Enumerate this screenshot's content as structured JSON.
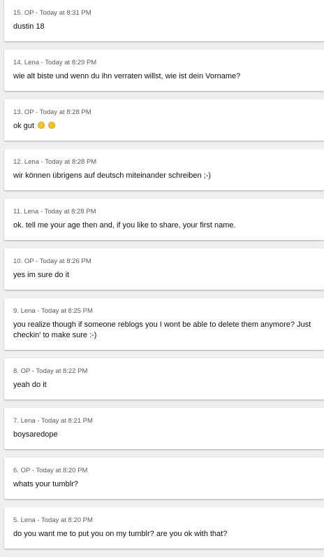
{
  "messages": [
    {
      "number": "15.",
      "author": "OP",
      "time": "Today at 8:31 PM",
      "text": "dustin 18"
    },
    {
      "number": "14.",
      "author": "Lena",
      "time": "Today at 8:29 PM",
      "text": "wie alt biste und wenn du ihn verraten willst, wie ist dein Vorname?"
    },
    {
      "number": "13.",
      "author": "OP",
      "time": "Today at 8:28 PM",
      "text": "ok gut",
      "emoji": [
        "laughing-crying-emoji",
        "laughing-crying-emoji"
      ]
    },
    {
      "number": "12.",
      "author": "Lena",
      "time": "Today at 8:28 PM",
      "text": "wir können übrigens auf deutsch miteinander schreiben ;-)"
    },
    {
      "number": "11.",
      "author": "Lena",
      "time": "Today at 8:28 PM",
      "text": "ok. tell me your age then and, if you like to share, your first name."
    },
    {
      "number": "10.",
      "author": "OP",
      "time": "Today at 8:26 PM",
      "text": "yes im sure do it"
    },
    {
      "number": "9.",
      "author": "Lena",
      "time": "Today at 8:25 PM",
      "text": "you realize though if someone reblogs you I wont be able to delete them anymore? Just checkin' to make sure :-)"
    },
    {
      "number": "8.",
      "author": "OP",
      "time": "Today at 8:22 PM",
      "text": "yeah do it"
    },
    {
      "number": "7.",
      "author": "Lena",
      "time": "Today at 8:21 PM",
      "text": "boysaredope"
    },
    {
      "number": "6.",
      "author": "OP",
      "time": "Today at 8:20 PM",
      "text": "whats your tumblr?"
    },
    {
      "number": "5.",
      "author": "Lena",
      "time": "Today at 8:20 PM",
      "text": "do you want me to put you on my tumblr? are you ok with that?"
    }
  ],
  "colors": {
    "background": "#efefef",
    "card": "#ffffff",
    "meta_text": "#5a5a5a",
    "message_text": "#111111",
    "emoji": "#f4c430"
  }
}
